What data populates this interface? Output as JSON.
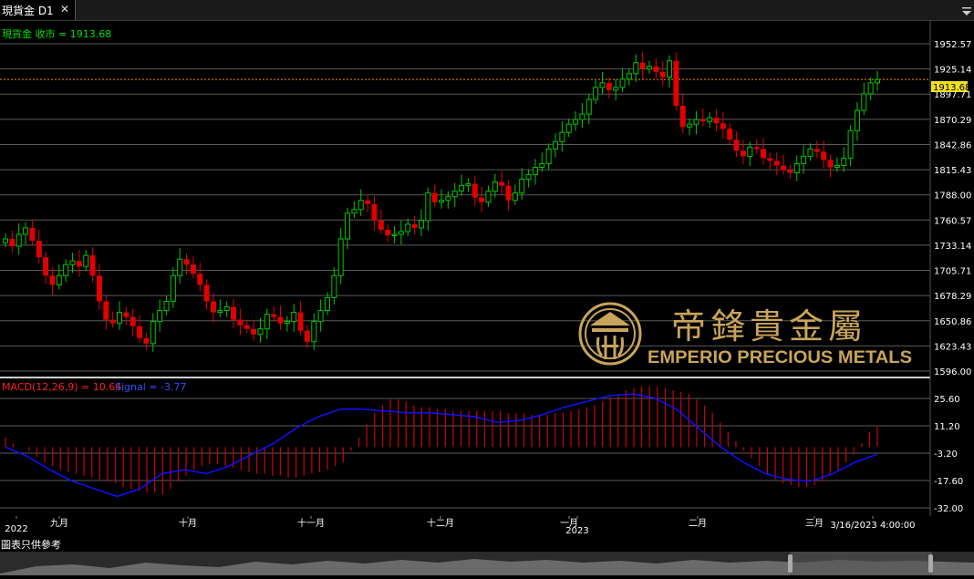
{
  "window": {
    "tab_title": "現貨金 D1",
    "close_glyph": "✕",
    "menu_icon": "menu-triangle-icon"
  },
  "price_panel": {
    "label": "現貨金 收市 = 1913.68",
    "current_price": "1913.68",
    "y_ticks": [
      "1952.57",
      "1925.14",
      "1897.71",
      "1870.29",
      "1842.86",
      "1815.43",
      "1788.00",
      "1760.57",
      "1733.14",
      "1705.71",
      "1678.29",
      "1650.86",
      "1623.43",
      "1596.00"
    ]
  },
  "macd_panel": {
    "label": "MACD(12,26,9) = 10.64",
    "signal_label": "Signal = -3.77",
    "y_ticks": [
      "25.60",
      "11.20",
      "-3.20",
      "-17.60",
      "-32.00"
    ]
  },
  "x_axis": {
    "labels": [
      "2022",
      "九月",
      "十月",
      "十一月",
      "十二月",
      "一月",
      "2023",
      "二月",
      "三月",
      "3/16/2023 4:00:00"
    ]
  },
  "watermark": {
    "name_cn": "帝鋒貴金屬",
    "name_en": "EMPERIO PRECIOUS METALS"
  },
  "footnote": "圖表只供參考",
  "colors": {
    "up": "#00c800",
    "down": "#e00000",
    "macd_hist": "#d00000",
    "signal": "#1010ff",
    "price_line": "#ff8c00",
    "gold": "#c9a55a"
  },
  "chart_data": {
    "type": "candlestick",
    "title": "現貨金 D1",
    "ylim": [
      1596.0,
      1952.57
    ],
    "close_series": [
      1740,
      1732,
      1745,
      1752,
      1738,
      1720,
      1700,
      1690,
      1700,
      1712,
      1716,
      1710,
      1722,
      1700,
      1672,
      1652,
      1648,
      1660,
      1655,
      1645,
      1632,
      1626,
      1650,
      1662,
      1672,
      1700,
      1718,
      1712,
      1702,
      1690,
      1672,
      1660,
      1662,
      1666,
      1652,
      1646,
      1642,
      1636,
      1642,
      1658,
      1655,
      1648,
      1650,
      1660,
      1640,
      1628,
      1650,
      1662,
      1676,
      1700,
      1740,
      1768,
      1772,
      1782,
      1778,
      1760,
      1750,
      1744,
      1745,
      1748,
      1756,
      1752,
      1760,
      1790,
      1780,
      1782,
      1786,
      1792,
      1798,
      1800,
      1785,
      1780,
      1792,
      1802,
      1798,
      1782,
      1790,
      1805,
      1810,
      1818,
      1822,
      1838,
      1846,
      1856,
      1865,
      1870,
      1876,
      1892,
      1905,
      1910,
      1902,
      1905,
      1914,
      1920,
      1932,
      1925,
      1928,
      1922,
      1916,
      1934,
      1885,
      1862,
      1865,
      1870,
      1868,
      1872,
      1866,
      1860,
      1848,
      1836,
      1830,
      1840,
      1838,
      1828,
      1825,
      1820,
      1815,
      1812,
      1822,
      1830,
      1838,
      1835,
      1826,
      1818,
      1820,
      1828,
      1858,
      1880,
      1898,
      1910,
      1913.68
    ],
    "macd_values": [
      5,
      2,
      0,
      -2,
      -5,
      -8,
      -10,
      -12,
      -13,
      -14,
      -15,
      -16,
      -17,
      -18,
      -19,
      -21,
      -22,
      -23,
      -24,
      -24,
      -25,
      -22,
      -18,
      -15,
      -12,
      -10,
      -9,
      -9,
      -10,
      -11,
      -12,
      -13,
      -14,
      -14,
      -15,
      -15,
      -16,
      -16,
      -15,
      -14,
      -13,
      -12,
      -10,
      -8,
      -2,
      5,
      12,
      18,
      22,
      25,
      25,
      24,
      22,
      21,
      21,
      20,
      20,
      19,
      19,
      19,
      19,
      19,
      19,
      19,
      18,
      18,
      18,
      17,
      17,
      17,
      18,
      18,
      19,
      20,
      21,
      22,
      24,
      26,
      28,
      30,
      31,
      32,
      32,
      32,
      31,
      30,
      29,
      28,
      25,
      22,
      18,
      13,
      8,
      3,
      -2,
      -6,
      -10,
      -14,
      -17,
      -19,
      -20,
      -21,
      -21,
      -20,
      -18,
      -15,
      -12,
      -8,
      -4,
      2,
      8,
      10.64
    ],
    "signal_values": [
      0,
      -5,
      -12,
      -18,
      -22,
      -26,
      -22,
      -14,
      -12,
      -14,
      -10,
      -4,
      2,
      10,
      16,
      20,
      20,
      19,
      18,
      18,
      17,
      16,
      13,
      14,
      17,
      21,
      24,
      27,
      28,
      26,
      20,
      10,
      0,
      -8,
      -14,
      -17,
      -18,
      -14,
      -8,
      -3.77
    ]
  }
}
